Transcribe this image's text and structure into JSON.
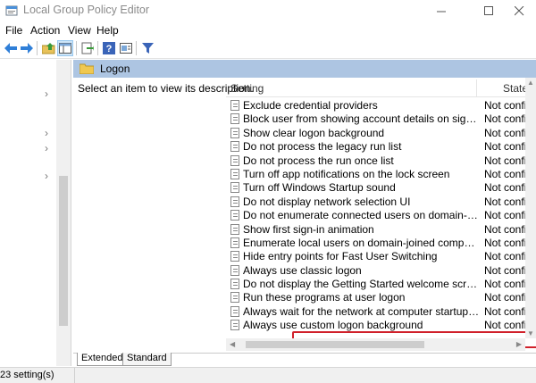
{
  "window": {
    "title": "Local Group Policy Editor",
    "controls": {
      "minimize": "–",
      "maximize": "☐",
      "close": "✕"
    }
  },
  "menu": [
    "File",
    "Action",
    "View",
    "Help"
  ],
  "toolbar": {
    "icons": [
      "back-icon",
      "forward-icon",
      "up-folder-icon",
      "show-hide-tree-icon",
      "export-list-icon",
      "help-icon",
      "properties-icon",
      "filter-icon"
    ]
  },
  "node": {
    "title": "Logon",
    "description": "Select an item to view its description."
  },
  "list": {
    "columns": {
      "setting": "Setting",
      "state": "State"
    },
    "rows": [
      {
        "setting": "Exclude credential providers",
        "state": "Not config"
      },
      {
        "setting": "Block user from showing account details on sign-in",
        "state": "Not config"
      },
      {
        "setting": "Show clear logon background",
        "state": "Not config"
      },
      {
        "setting": "Do not process the legacy run list",
        "state": "Not config"
      },
      {
        "setting": "Do not process the run once list",
        "state": "Not config"
      },
      {
        "setting": "Turn off app notifications on the lock screen",
        "state": "Not config"
      },
      {
        "setting": "Turn off Windows Startup sound",
        "state": "Not config"
      },
      {
        "setting": "Do not display network selection UI",
        "state": "Not config"
      },
      {
        "setting": "Do not enumerate connected users on domain-joined com...",
        "state": "Not config"
      },
      {
        "setting": "Show first sign-in animation",
        "state": "Not config"
      },
      {
        "setting": "Enumerate local users on domain-joined computers",
        "state": "Not config"
      },
      {
        "setting": "Hide entry points for Fast User Switching",
        "state": "Not config"
      },
      {
        "setting": "Always use classic logon",
        "state": "Not config"
      },
      {
        "setting": "Do not display the Getting Started welcome screen at logon",
        "state": "Not config"
      },
      {
        "setting": "Run these programs at user logon",
        "state": "Not config"
      },
      {
        "setting": "Always wait for the network at computer startup and logon",
        "state": "Not config"
      },
      {
        "setting": "Always use custom logon background",
        "state": "Not config"
      }
    ],
    "highlighted_index": 13
  },
  "tabs": [
    {
      "label": "Extended",
      "selected": true
    },
    {
      "label": "Standard",
      "selected": false
    }
  ],
  "status": {
    "text": "23 setting(s)"
  },
  "colors": {
    "header_band": "#adc5e2",
    "highlight": "#d0202a"
  }
}
